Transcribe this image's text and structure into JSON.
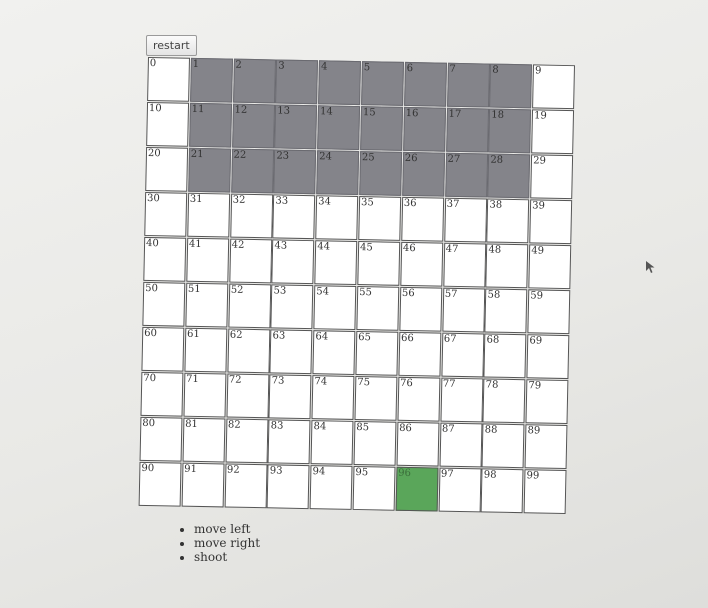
{
  "restart_label": "restart",
  "board": {
    "rows": 10,
    "cols": 10,
    "cells": [
      "0",
      "1",
      "2",
      "3",
      "4",
      "5",
      "6",
      "7",
      "8",
      "9",
      "10",
      "11",
      "12",
      "13",
      "14",
      "15",
      "16",
      "17",
      "18",
      "19",
      "20",
      "21",
      "22",
      "23",
      "24",
      "25",
      "26",
      "27",
      "28",
      "29",
      "30",
      "31",
      "32",
      "33",
      "34",
      "35",
      "36",
      "37",
      "38",
      "39",
      "40",
      "41",
      "42",
      "43",
      "44",
      "45",
      "46",
      "47",
      "48",
      "49",
      "50",
      "51",
      "52",
      "53",
      "54",
      "55",
      "56",
      "57",
      "58",
      "59",
      "60",
      "61",
      "62",
      "63",
      "64",
      "65",
      "66",
      "67",
      "68",
      "69",
      "70",
      "71",
      "72",
      "73",
      "74",
      "75",
      "76",
      "77",
      "78",
      "79",
      "80",
      "81",
      "82",
      "83",
      "84",
      "85",
      "86",
      "87",
      "88",
      "89",
      "90",
      "91",
      "92",
      "93",
      "94",
      "95",
      "96",
      "97",
      "98",
      "99"
    ],
    "enemy_cells": [
      1,
      2,
      3,
      4,
      5,
      6,
      7,
      8,
      11,
      12,
      13,
      14,
      15,
      16,
      17,
      18,
      21,
      22,
      23,
      24,
      25,
      26,
      27,
      28
    ],
    "player_cell": 96,
    "colors": {
      "enemy": "#84848a",
      "player": "#5aa65a",
      "empty": "#ffffff"
    }
  },
  "controls": [
    "move left",
    "move right",
    "shoot"
  ]
}
